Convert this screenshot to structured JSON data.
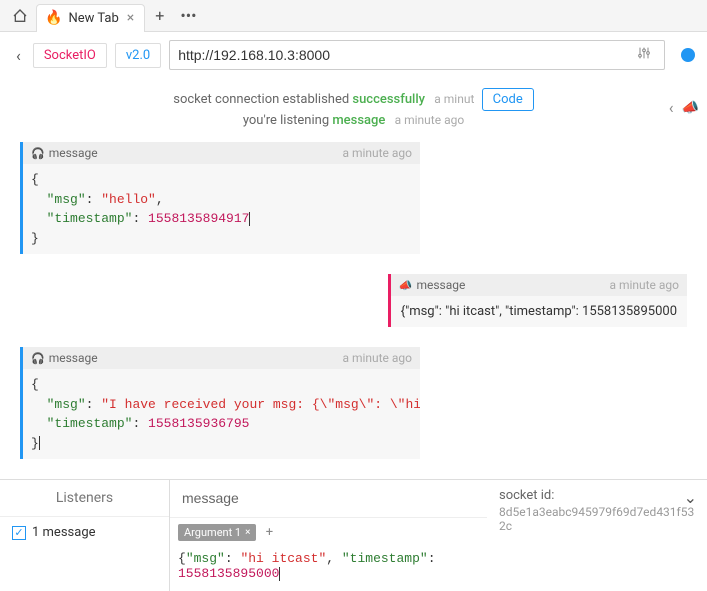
{
  "browser": {
    "tab_icon": "🔥",
    "tab_title": "New Tab",
    "tab_close": "×",
    "new_tab": "+",
    "more": "•••"
  },
  "toolbar": {
    "back": "‹",
    "socketio_label": "SocketIO",
    "version_label": "v2.0",
    "url": "http://192.168.10.3:8000"
  },
  "status": {
    "line1_pre": "socket connection established ",
    "line1_success": "successfully",
    "line1_time": "a minut",
    "code_btn": "Code",
    "line2_pre": "you're listening ",
    "line2_event": "message",
    "line2_time": "a minute ago"
  },
  "messages": [
    {
      "side": "left",
      "icon": "headphone",
      "label": "message",
      "time": "a minute ago",
      "body_type": "json",
      "json": {
        "msg": "hello",
        "timestamp": 1558135894917
      }
    },
    {
      "side": "right",
      "icon": "megaphone",
      "label": "message",
      "time": "a minute ago",
      "body_type": "plain",
      "plain": "{\"msg\": \"hi itcast\", \"timestamp\": 1558135895000"
    },
    {
      "side": "left",
      "icon": "headphone",
      "label": "message",
      "time": "a minute ago",
      "body_type": "json",
      "json": {
        "msg": "I have received your msg: {\\\"msg\\\": \\\"hi",
        "timestamp": 1558135936795
      }
    }
  ],
  "bottom": {
    "listeners_title": "Listeners",
    "listener_item": "1 message",
    "msg_input_placeholder": "message",
    "arg_tab": "Argument 1",
    "arg_tab_close": "×",
    "arg_plus": "+",
    "arg_body_pre": "{",
    "arg_key1": "\"msg\"",
    "arg_val1": "\"hi itcast\"",
    "arg_key2": "\"timestamp\"",
    "arg_val2": "1558135895000",
    "socket_label": "socket id:",
    "socket_id": "8d5e1a3eabc945979f69d7ed431f532c"
  }
}
